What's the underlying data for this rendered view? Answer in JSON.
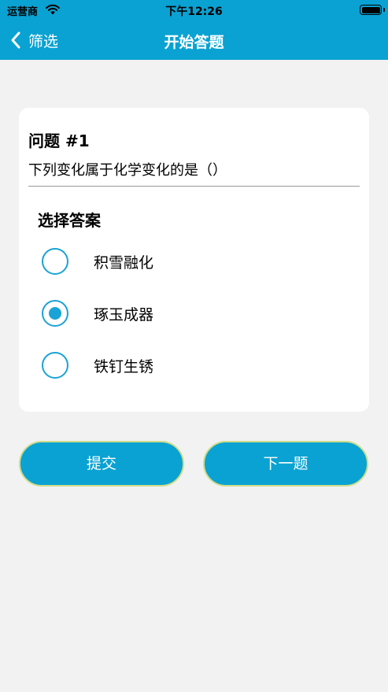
{
  "status_bar": {
    "carrier": "运营商",
    "time": "下午12:26"
  },
  "nav": {
    "back_label": "筛选",
    "title": "开始答题"
  },
  "question": {
    "number": "问题 #1",
    "text": "下列变化属于化学变化的是（）",
    "answers_label": "选择答案",
    "options": [
      {
        "label": "积雪融化",
        "selected": false
      },
      {
        "label": "琢玉成器",
        "selected": true
      },
      {
        "label": "铁钉生锈",
        "selected": false
      }
    ]
  },
  "buttons": {
    "submit": "提交",
    "next": "下一题"
  },
  "colors": {
    "accent": "#0aa2d2",
    "radio": "#1aa3d6",
    "button_border": "#cfdc8a",
    "background": "#f2f2f2"
  },
  "icons": {
    "back": "chevron-left-icon",
    "wifi": "wifi-icon",
    "battery": "battery-icon"
  }
}
